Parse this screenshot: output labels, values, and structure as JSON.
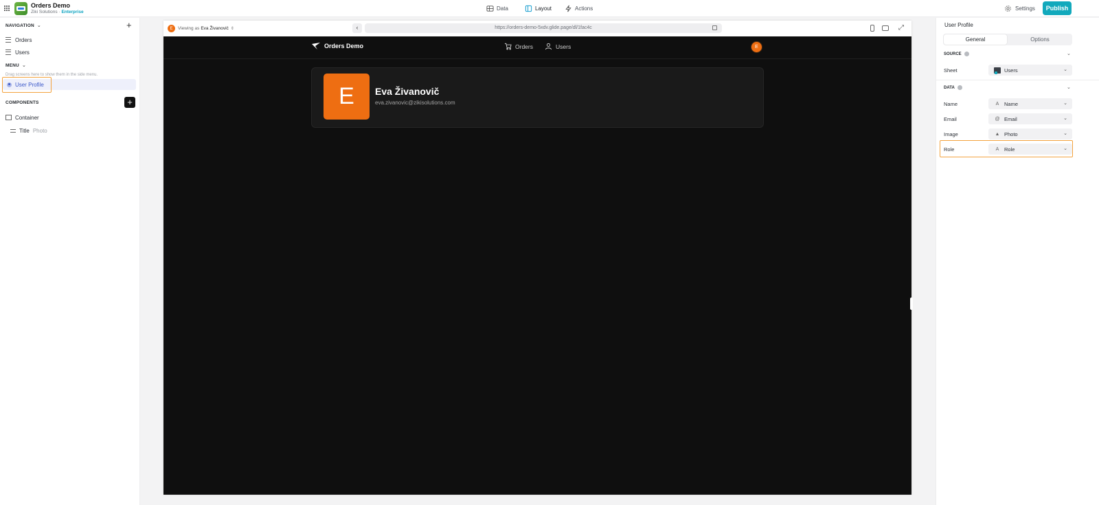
{
  "app": {
    "title": "Orders Demo",
    "org": "Ziki Solutions · ",
    "plan": "Enterprise"
  },
  "topnav": {
    "data": "Data",
    "layout": "Layout",
    "actions": "Actions",
    "settings": "Settings",
    "publish": "Publish"
  },
  "left": {
    "navigation_title": "NAVIGATION",
    "nav_items": [
      {
        "label": "Orders"
      },
      {
        "label": "Users"
      }
    ],
    "menu_title": "MENU",
    "menu_hint": "Drag screens here to show them in the side menu.",
    "selected_screen": "User Profile",
    "components_title": "COMPONENTS",
    "components": [
      {
        "label": "Container"
      },
      {
        "label": "Title",
        "sub": "Photo"
      }
    ]
  },
  "preview": {
    "viewing_as_prefix": "Viewing as",
    "viewing_as_name": "Eva Živanovič",
    "url": "https://orders-demo-5xdv.glide.page/dl/1fac4c",
    "app_brand": "Orders Demo",
    "app_nav": [
      {
        "label": "Orders"
      },
      {
        "label": "Users"
      }
    ],
    "user_initial": "E",
    "profile": {
      "initial": "E",
      "name": "Eva Živanovič",
      "email": "eva.zivanovic@zikisolutions.com"
    }
  },
  "right": {
    "title": "User Profile",
    "tabs": {
      "general": "General",
      "options": "Options"
    },
    "source_title": "SOURCE",
    "sheet_label": "Sheet",
    "sheet_value": "Users",
    "data_title": "DATA",
    "fields": [
      {
        "label": "Name",
        "value": "Name",
        "icon": "text-icon"
      },
      {
        "label": "Email",
        "value": "Email",
        "icon": "at-icon"
      },
      {
        "label": "Image",
        "value": "Photo",
        "icon": "image-icon"
      },
      {
        "label": "Role",
        "value": "Role",
        "icon": "text-icon"
      }
    ]
  },
  "colors": {
    "accent": "#12a9bc",
    "avatar": "#ee6e12",
    "highlight": "#f3a23d",
    "selection": "#3c59c9"
  }
}
